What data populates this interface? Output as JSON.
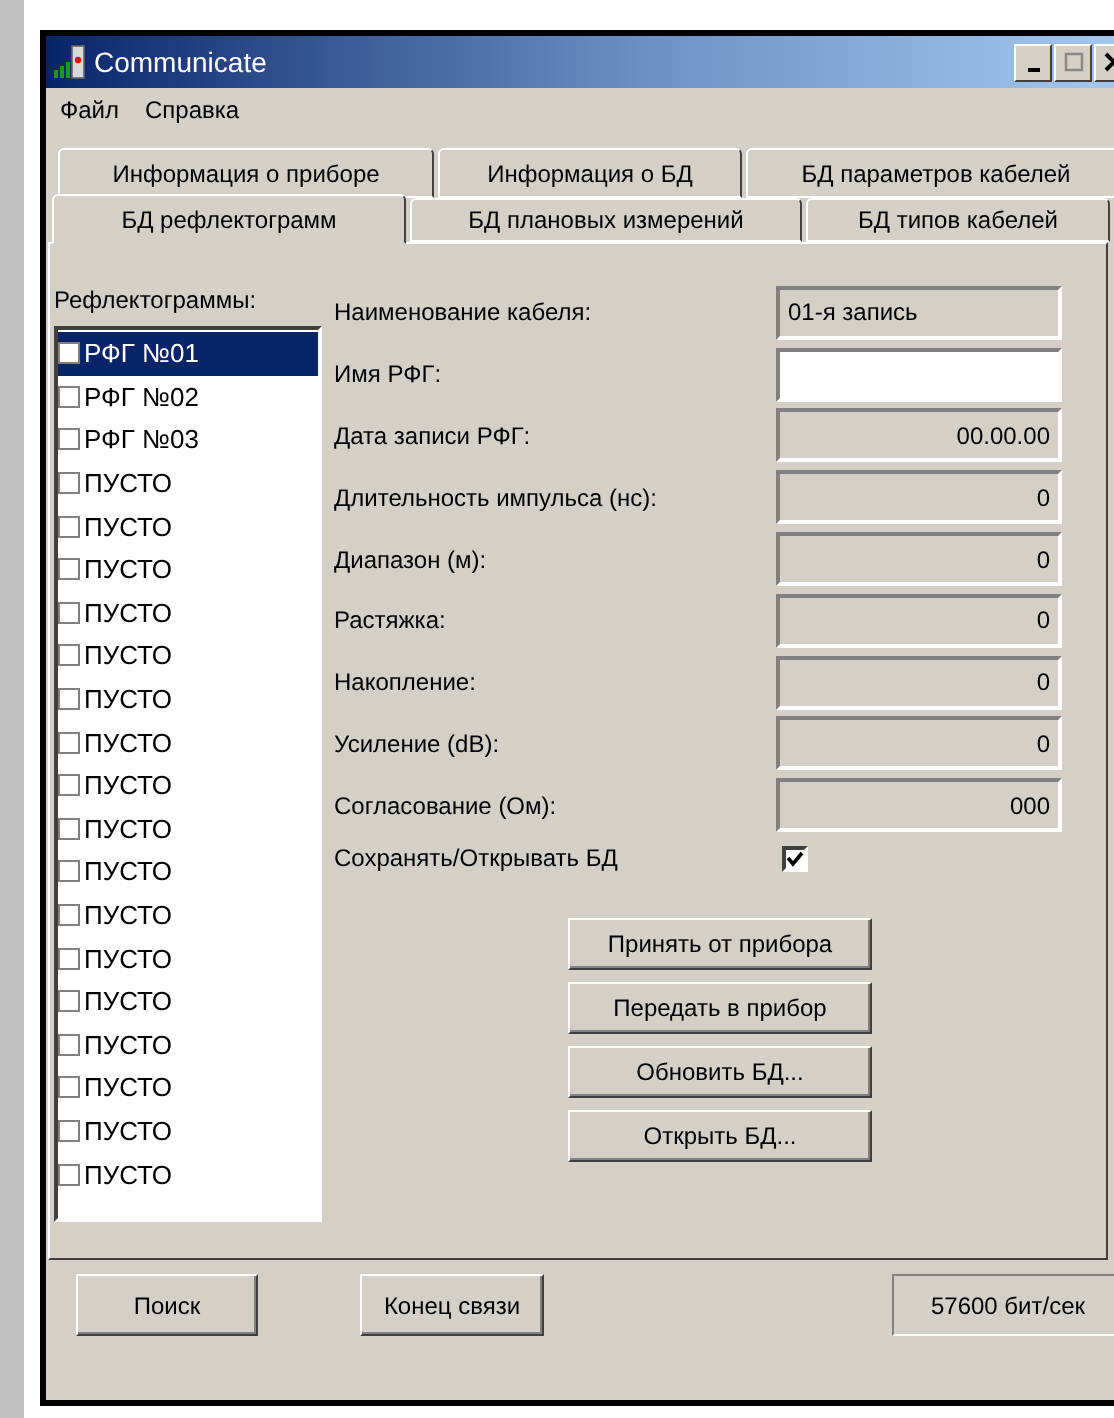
{
  "window": {
    "title": "Communicate"
  },
  "menu": [
    "Файл",
    "Справка"
  ],
  "tab_rows": [
    [
      {
        "label": "Информация о приборе",
        "selected": false
      },
      {
        "label": "Информация о БД",
        "selected": false
      },
      {
        "label": "БД параметров кабелей",
        "selected": false
      }
    ],
    [
      {
        "label": "БД рефлектограмм",
        "selected": true
      },
      {
        "label": "БД плановых измерений",
        "selected": false
      },
      {
        "label": "БД типов кабелей",
        "selected": false
      }
    ]
  ],
  "list_label": "Рефлектограммы:",
  "reflectograms": [
    {
      "label": "РФГ №01",
      "selected": true
    },
    {
      "label": "РФГ №02",
      "selected": false
    },
    {
      "label": "РФГ №03",
      "selected": false
    },
    {
      "label": "ПУСТО",
      "selected": false
    },
    {
      "label": "ПУСТО",
      "selected": false
    },
    {
      "label": "ПУСТО",
      "selected": false
    },
    {
      "label": "ПУСТО",
      "selected": false
    },
    {
      "label": "ПУСТО",
      "selected": false
    },
    {
      "label": "ПУСТО",
      "selected": false
    },
    {
      "label": "ПУСТО",
      "selected": false
    },
    {
      "label": "ПУСТО",
      "selected": false
    },
    {
      "label": "ПУСТО",
      "selected": false
    },
    {
      "label": "ПУСТО",
      "selected": false
    },
    {
      "label": "ПУСТО",
      "selected": false
    },
    {
      "label": "ПУСТО",
      "selected": false
    },
    {
      "label": "ПУСТО",
      "selected": false
    },
    {
      "label": "ПУСТО",
      "selected": false
    },
    {
      "label": "ПУСТО",
      "selected": false
    },
    {
      "label": "ПУСТО",
      "selected": false
    },
    {
      "label": "ПУСТО",
      "selected": false
    }
  ],
  "fields": [
    {
      "label": "Наименование кабеля:",
      "kind": "text",
      "value": "01-я запись"
    },
    {
      "label": "Имя РФГ:",
      "kind": "input"
    },
    {
      "label": "Дата записи РФГ:",
      "kind": "numeric",
      "value": "00.00.00"
    },
    {
      "label": "Длительность импульса (нс):",
      "kind": "numeric",
      "value": "0"
    },
    {
      "label": "Диапазон (м):",
      "kind": "numeric",
      "value": "0"
    },
    {
      "label": "Растяжка:",
      "kind": "numeric",
      "value": "0"
    },
    {
      "label": "Накопление:",
      "kind": "numeric",
      "value": "0"
    },
    {
      "label": "Усиление (dB):",
      "kind": "numeric",
      "value": "0"
    },
    {
      "label": "Согласование (Ом):",
      "kind": "numeric",
      "value": "000"
    }
  ],
  "save_option": {
    "label": "Сохранять/Открывать БД",
    "checked": true
  },
  "actions": [
    "Принять от прибора",
    "Передать в прибор",
    "Обновить БД...",
    "Открыть БД..."
  ],
  "footer_buttons": [
    "Поиск",
    "Конец связи"
  ],
  "status": "57600 бит/сек"
}
